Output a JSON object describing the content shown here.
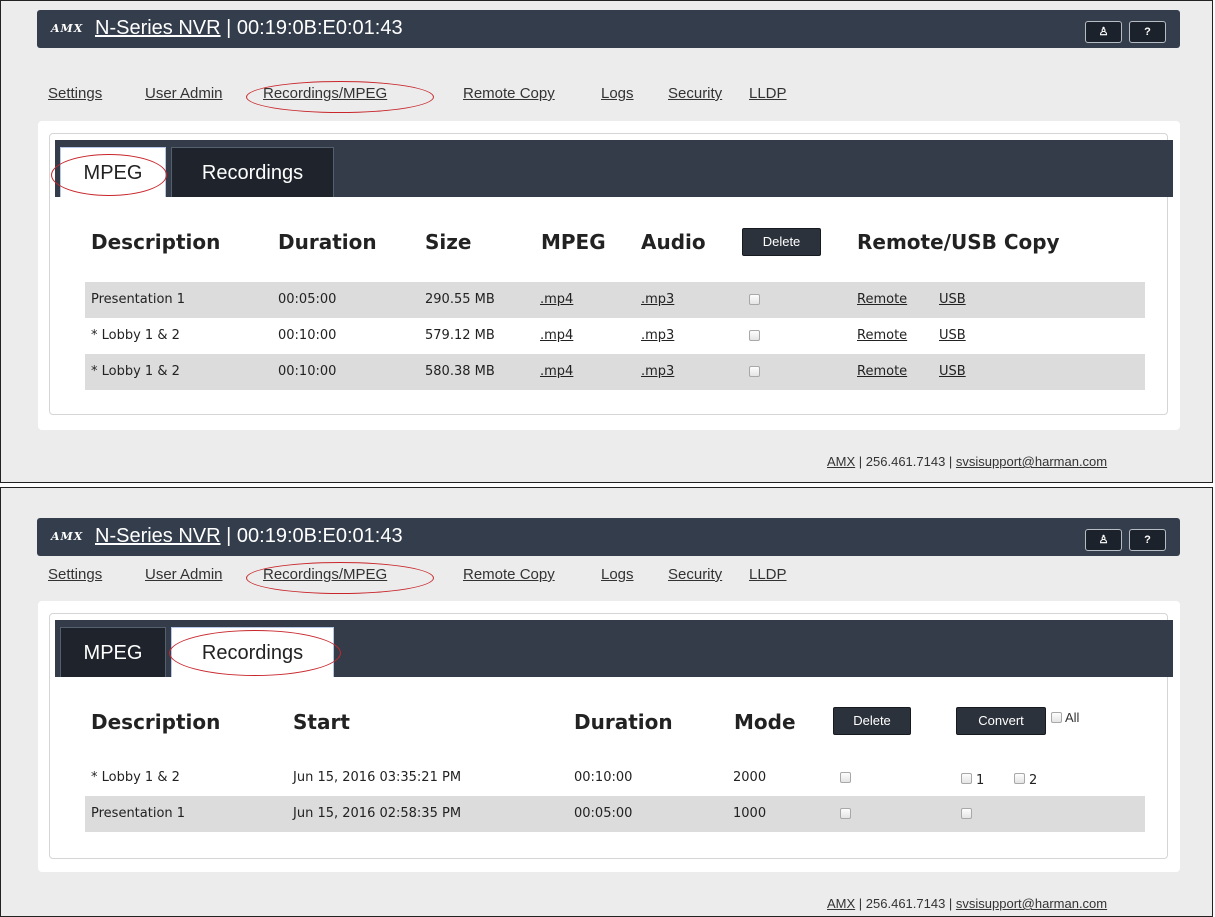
{
  "app": {
    "logo": "AMX",
    "device_name": "N-Series NVR",
    "separator": " | ",
    "device_id": "00:19:0B:E0:01:43",
    "user_button": "♙",
    "help_button": "?"
  },
  "nav": [
    "Settings",
    "User Admin",
    "Recordings/MPEG",
    "Remote Copy",
    "Logs",
    "Security",
    "LLDP"
  ],
  "footer": {
    "brand": "AMX",
    "sep1": " | ",
    "phone": "256.461.7143",
    "sep2": " | ",
    "email": "svsisupport@harman.com"
  },
  "annotation_color": "#c8262b",
  "mpeg_screen": {
    "active_tab": "MPEG",
    "tabs": [
      "MPEG",
      "Recordings"
    ],
    "columns": [
      "Description",
      "Duration",
      "Size",
      "MPEG",
      "Audio"
    ],
    "delete_label": "Delete",
    "copy_header": "Remote/USB Copy",
    "rows": [
      {
        "description": "Presentation 1",
        "duration": "00:05:00",
        "size": "290.55 MB",
        "mpeg": ".mp4",
        "audio": ".mp3",
        "remote": "Remote",
        "usb": "USB",
        "checked": false
      },
      {
        "description": "* Lobby 1 & 2",
        "duration": "00:10:00",
        "size": "579.12 MB",
        "mpeg": ".mp4",
        "audio": ".mp3",
        "remote": "Remote",
        "usb": "USB",
        "checked": false
      },
      {
        "description": "* Lobby 1 & 2",
        "duration": "00:10:00",
        "size": "580.38 MB",
        "mpeg": ".mp4",
        "audio": ".mp3",
        "remote": "Remote",
        "usb": "USB",
        "checked": false
      }
    ]
  },
  "recordings_screen": {
    "active_tab": "Recordings",
    "tabs": [
      "MPEG",
      "Recordings"
    ],
    "columns": [
      "Description",
      "Start",
      "Duration",
      "Mode"
    ],
    "delete_label": "Delete",
    "convert_label": "Convert",
    "all_label": "All",
    "rows": [
      {
        "description": "* Lobby 1 & 2",
        "start": "Jun 15, 2016 03:35:21 PM",
        "duration": "00:10:00",
        "mode": "2000",
        "stream1": "1",
        "stream2": "2"
      },
      {
        "description": "Presentation 1",
        "start": "Jun 15, 2016 02:58:35 PM",
        "duration": "00:05:00",
        "mode": "1000"
      }
    ]
  }
}
